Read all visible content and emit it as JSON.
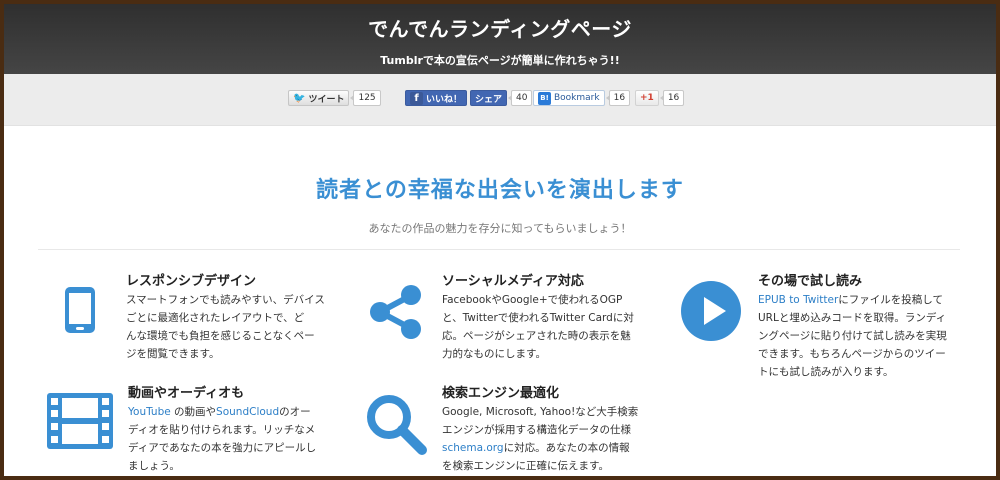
{
  "header": {
    "title": "でんでんランディングページ",
    "subtitle": "Tumblrで本の宣伝ページが簡単に作れちゃう!!"
  },
  "share": {
    "tweet_label": "ツイート",
    "tweet_count": "125",
    "like_label": "いいね！",
    "fb_share_label": "シェア",
    "fb_count": "40",
    "bookmark_label": "Bookmark",
    "bookmark_count": "16",
    "gplus_label": "+1",
    "gplus_count": "16"
  },
  "main": {
    "headline": "読者との幸福な出会いを演出します",
    "lead": "あなたの作品の魅力を存分に知ってもらいましょう！"
  },
  "features": [
    {
      "title": "レスポンシブデザイン",
      "icon": "smartphone-icon",
      "lines": [
        "スマートフォンでも読みやすい、デバイス",
        "ごとに最適化されたレイアウトで、ど",
        "んな環境でも負担を感じることなくペー",
        "ジを閲覧できます。"
      ]
    },
    {
      "title": "ソーシャルメディア対応",
      "icon": "share-icon",
      "lines": [
        "FacebookやGoogle+で使われるOGP",
        "と、Twitterで使われるTwitter Cardに対",
        "応。ページがシェアされた時の表示を魅",
        "力的なものにします。"
      ]
    },
    {
      "title": "その場で試し読み",
      "icon": "play-icon",
      "link": "EPUB to Twitter",
      "lines": [
        "にファイルを投稿して",
        "URLと埋め込みコードを取得。ランディ",
        "ングページに貼り付けて試し読みを実現",
        "できます。もちろんページからのツイー",
        "トにも試し読みが入ります。"
      ]
    },
    {
      "title": "動画やオーディオも",
      "icon": "film-icon",
      "link1": "YouTube",
      "mid1": " の動画や",
      "link2": "SoundCloud",
      "lines": [
        "のオー",
        "ディオを貼り付けられます。リッチなメ",
        "ディアであなたの本を強力にアピールし",
        "ましょう。"
      ]
    },
    {
      "title": "検索エンジン最適化",
      "icon": "search-icon",
      "link": "schema.org",
      "lines": [
        "Google, Microsoft, Yahoo!など大手検索",
        "エンジンが採用する構造化データの仕様",
        "に対応。あなたの本の情報",
        "を検索エンジンに正確に伝えます。"
      ]
    }
  ],
  "colors": {
    "accent": "#3a8fd3",
    "header_bg": "#3a3a3a",
    "frame": "#4a2c12"
  }
}
